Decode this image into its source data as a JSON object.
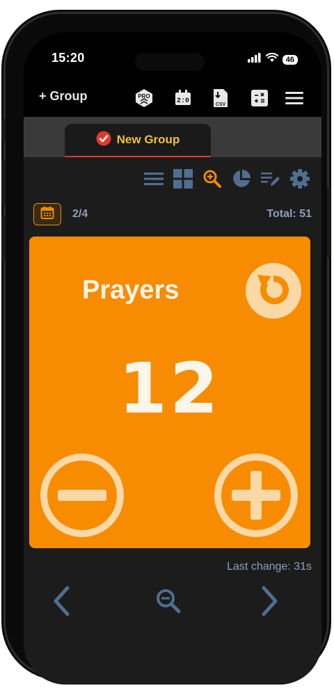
{
  "status_bar": {
    "time": "15:20",
    "battery": "46",
    "icons": [
      "signal-icon",
      "wifi-icon",
      "battery-icon"
    ]
  },
  "toolbar": {
    "group_label": "+ Group",
    "icons": [
      "pro-icon",
      "scoreboard-icon",
      "csv-export-icon",
      "calculator-icon",
      "menu-icon"
    ]
  },
  "tabs": [
    {
      "label": "New Group",
      "status": "checked",
      "active": true
    }
  ],
  "view_icons": [
    "list-view-icon",
    "grid-view-icon",
    "zoom-in-icon",
    "pie-chart-icon",
    "edit-list-icon",
    "settings-icon"
  ],
  "info": {
    "page": "2/4",
    "total": "Total: 51"
  },
  "counter": {
    "name": "Prayers",
    "value": "12",
    "color": "#f78c00"
  },
  "last_change": "Last change: 31s",
  "bottom_nav": [
    "prev-icon",
    "zoom-out-icon",
    "next-icon"
  ],
  "colors": {
    "accent": "#f78c00",
    "tab_label": "#f2c22f",
    "tab_underline": "#e2382f",
    "muted_text": "#8fa0b8",
    "icon_blue": "#4f6f91"
  }
}
